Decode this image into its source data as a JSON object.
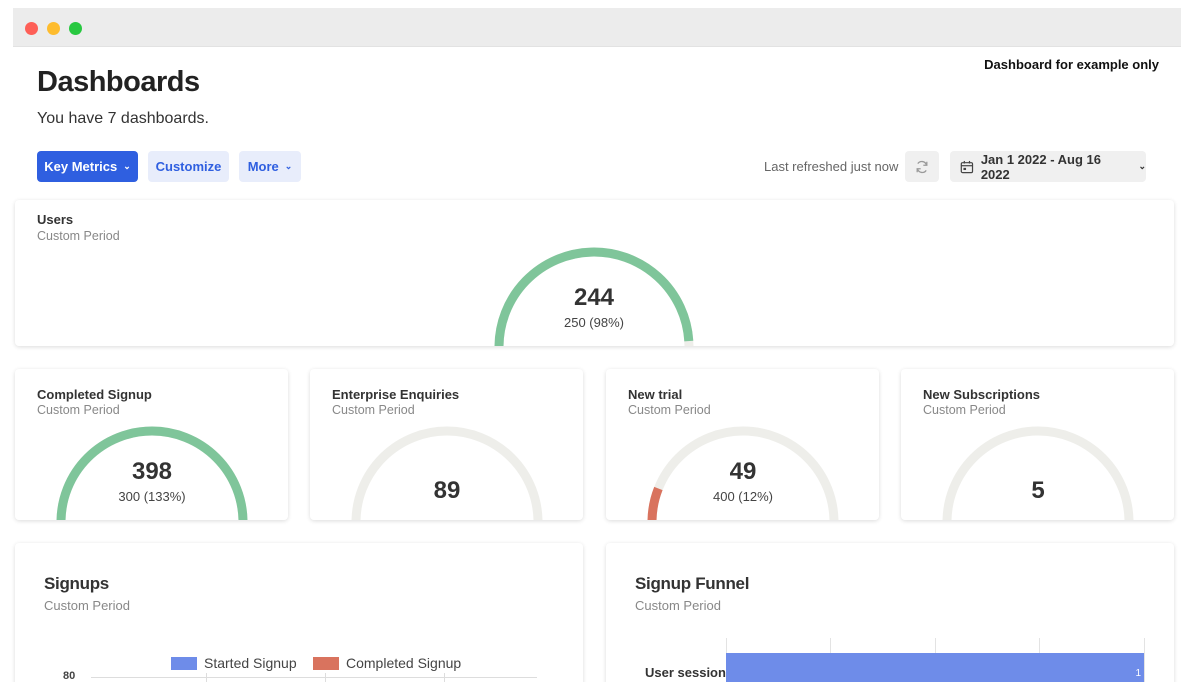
{
  "window": {},
  "note": "Dashboard for example only",
  "header": {
    "title": "Dashboards",
    "subtitle": "You have 7 dashboards."
  },
  "toolbar": {
    "key_metrics_label": "Key Metrics",
    "customize_label": "Customize",
    "more_label": "More",
    "last_refreshed": "Last refreshed just now",
    "date_range": "Jan 1 2022 - Aug 16 2022"
  },
  "colors": {
    "accent": "#2f5fe0",
    "gauge_green": "#7fc59a",
    "gauge_track": "#eeeeea",
    "gauge_red": "#d9735e",
    "started_signup": "#6e8ce9",
    "completed_signup": "#d9735e"
  },
  "users_card": {
    "title": "Users",
    "subtitle": "Custom Period",
    "value": "244",
    "target": "250 (98%)",
    "fraction": 0.98
  },
  "metric_cards": [
    {
      "title": "Completed Signup",
      "subtitle": "Custom Period",
      "value": "398",
      "target": "300 (133%)",
      "fraction": 1.0,
      "color": "#7fc59a"
    },
    {
      "title": "Enterprise Enquiries",
      "subtitle": "Custom Period",
      "value": "89",
      "target": "",
      "fraction": 0,
      "color": "#7fc59a"
    },
    {
      "title": "New trial",
      "subtitle": "Custom Period",
      "value": "49",
      "target": "400 (12%)",
      "fraction": 0.12,
      "color": "#d9735e"
    },
    {
      "title": "New Subscriptions",
      "subtitle": "Custom Period",
      "value": "5",
      "target": "",
      "fraction": 0,
      "color": "#7fc59a"
    }
  ],
  "signups": {
    "title": "Signups",
    "subtitle": "Custom Period",
    "legend": [
      "Started Signup",
      "Completed Signup"
    ],
    "y_tick_top": "80"
  },
  "funnel": {
    "title": "Signup Funnel",
    "subtitle": "Custom Period",
    "row_label": "User session",
    "row_value": "1"
  },
  "chart_data": [
    {
      "type": "bar",
      "title": "Signups",
      "series": [
        {
          "name": "Started Signup",
          "values": []
        },
        {
          "name": "Completed Signup",
          "values": []
        }
      ],
      "ylim": [
        0,
        80
      ]
    },
    {
      "type": "bar",
      "title": "Signup Funnel",
      "categories": [
        "User session"
      ],
      "values": [
        1
      ]
    }
  ]
}
